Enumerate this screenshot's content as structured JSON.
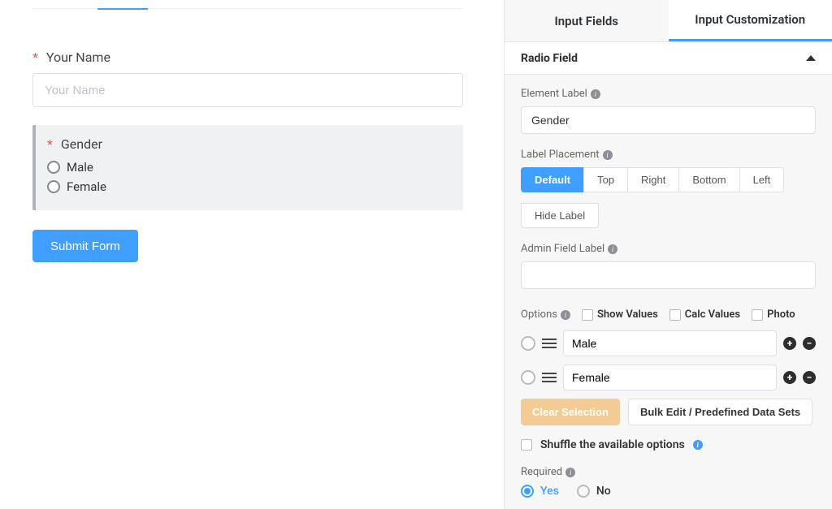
{
  "preview": {
    "name_label": "Your Name",
    "name_placeholder": "Your Name",
    "gender_label": "Gender",
    "gender_options": {
      "opt0": "Male",
      "opt1": "Female"
    },
    "submit_label": "Submit Form"
  },
  "tabs": {
    "input_fields": "Input Fields",
    "input_customization": "Input Customization"
  },
  "section_title": "Radio Field",
  "element_label_caption": "Element Label",
  "element_label_value": "Gender",
  "label_placement_caption": "Label Placement",
  "placement": {
    "default": "Default",
    "top": "Top",
    "right": "Right",
    "bottom": "Bottom",
    "left": "Left",
    "hide": "Hide Label"
  },
  "admin_label_caption": "Admin Field Label",
  "admin_label_value": "",
  "options": {
    "caption": "Options",
    "show_values": "Show Values",
    "calc_values": "Calc Values",
    "photo": "Photo",
    "items": {
      "i0": "Male",
      "i1": "Female"
    }
  },
  "clear_selection": "Clear Selection",
  "bulk_edit": "Bulk Edit / Predefined Data Sets",
  "shuffle_label": "Shuffle the available options",
  "required_caption": "Required",
  "required_yes": "Yes",
  "required_no": "No"
}
